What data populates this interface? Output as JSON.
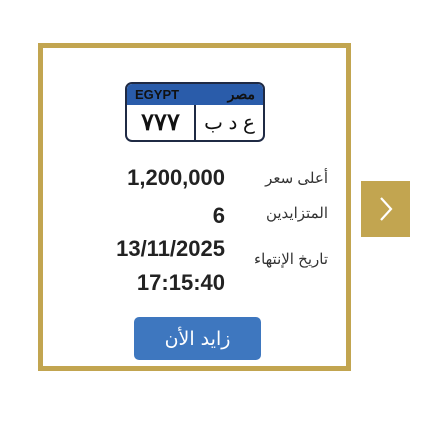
{
  "plate": {
    "country_en": "EGYPT",
    "country_ar": "مصر",
    "number": "٧٧٧",
    "letters": "ع د ب"
  },
  "auction": {
    "highest_price_label": "أعلى سعر",
    "highest_price_value": "1,200,000",
    "bidders_label": "المتزايدين",
    "bidders_value": "6",
    "end_date_label": "تاريخ الإنتهاء",
    "end_date_value": "13/11/2025",
    "end_time_value": "17:15:40"
  },
  "bid_button_label": "زايد الأن",
  "colors": {
    "accent": "#c2a550",
    "button": "#3e77bf",
    "plate_band": "#2a5caa"
  },
  "icons": {
    "next": "chevron-right-icon"
  }
}
